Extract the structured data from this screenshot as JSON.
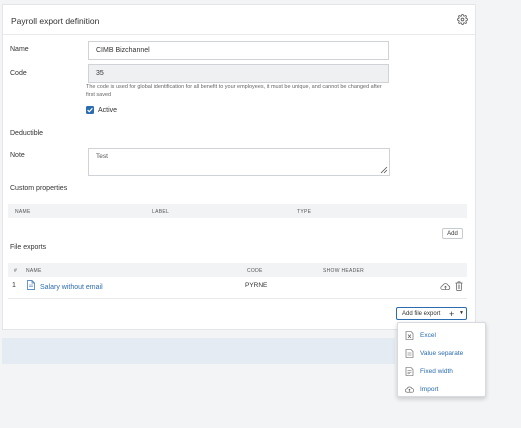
{
  "header": {
    "title": "Payroll export definition",
    "settings_icon": "gear-icon"
  },
  "form": {
    "name_label": "Name",
    "name_value": "CIMB Bizchannel",
    "code_label": "Code",
    "code_value": "35",
    "code_help": "The code is used for global identification for all benefit to your employees, it must be unique, and cannot be changed after first saved",
    "active_label": "Active",
    "active_checked": true,
    "deductible_label": "Deductible",
    "note_label": "Note",
    "note_value": "Test"
  },
  "custom_properties": {
    "title": "Custom properties",
    "columns": [
      "NAME",
      "LABEL",
      "TYPE"
    ],
    "rows": [],
    "add_label": "Add"
  },
  "file_exports": {
    "title": "File exports",
    "columns": [
      "#",
      "NAME",
      "CODE",
      "SHOW HEADER"
    ],
    "rows": [
      {
        "num": "1",
        "name": "Salary without email",
        "code": "PYRNE",
        "show_header": ""
      }
    ],
    "add_label": "Add file export"
  },
  "dropdown": {
    "items": [
      {
        "label": "Excel",
        "icon": "excel-file-icon"
      },
      {
        "label": "Value separate",
        "icon": "csv-file-icon"
      },
      {
        "label": "Fixed width",
        "icon": "text-file-icon"
      },
      {
        "label": "Import",
        "icon": "cloud-upload-icon"
      }
    ]
  },
  "colors": {
    "accent": "#2b6cb0",
    "bar": "#e4ebf3",
    "table_header": "#f1f3f5"
  }
}
